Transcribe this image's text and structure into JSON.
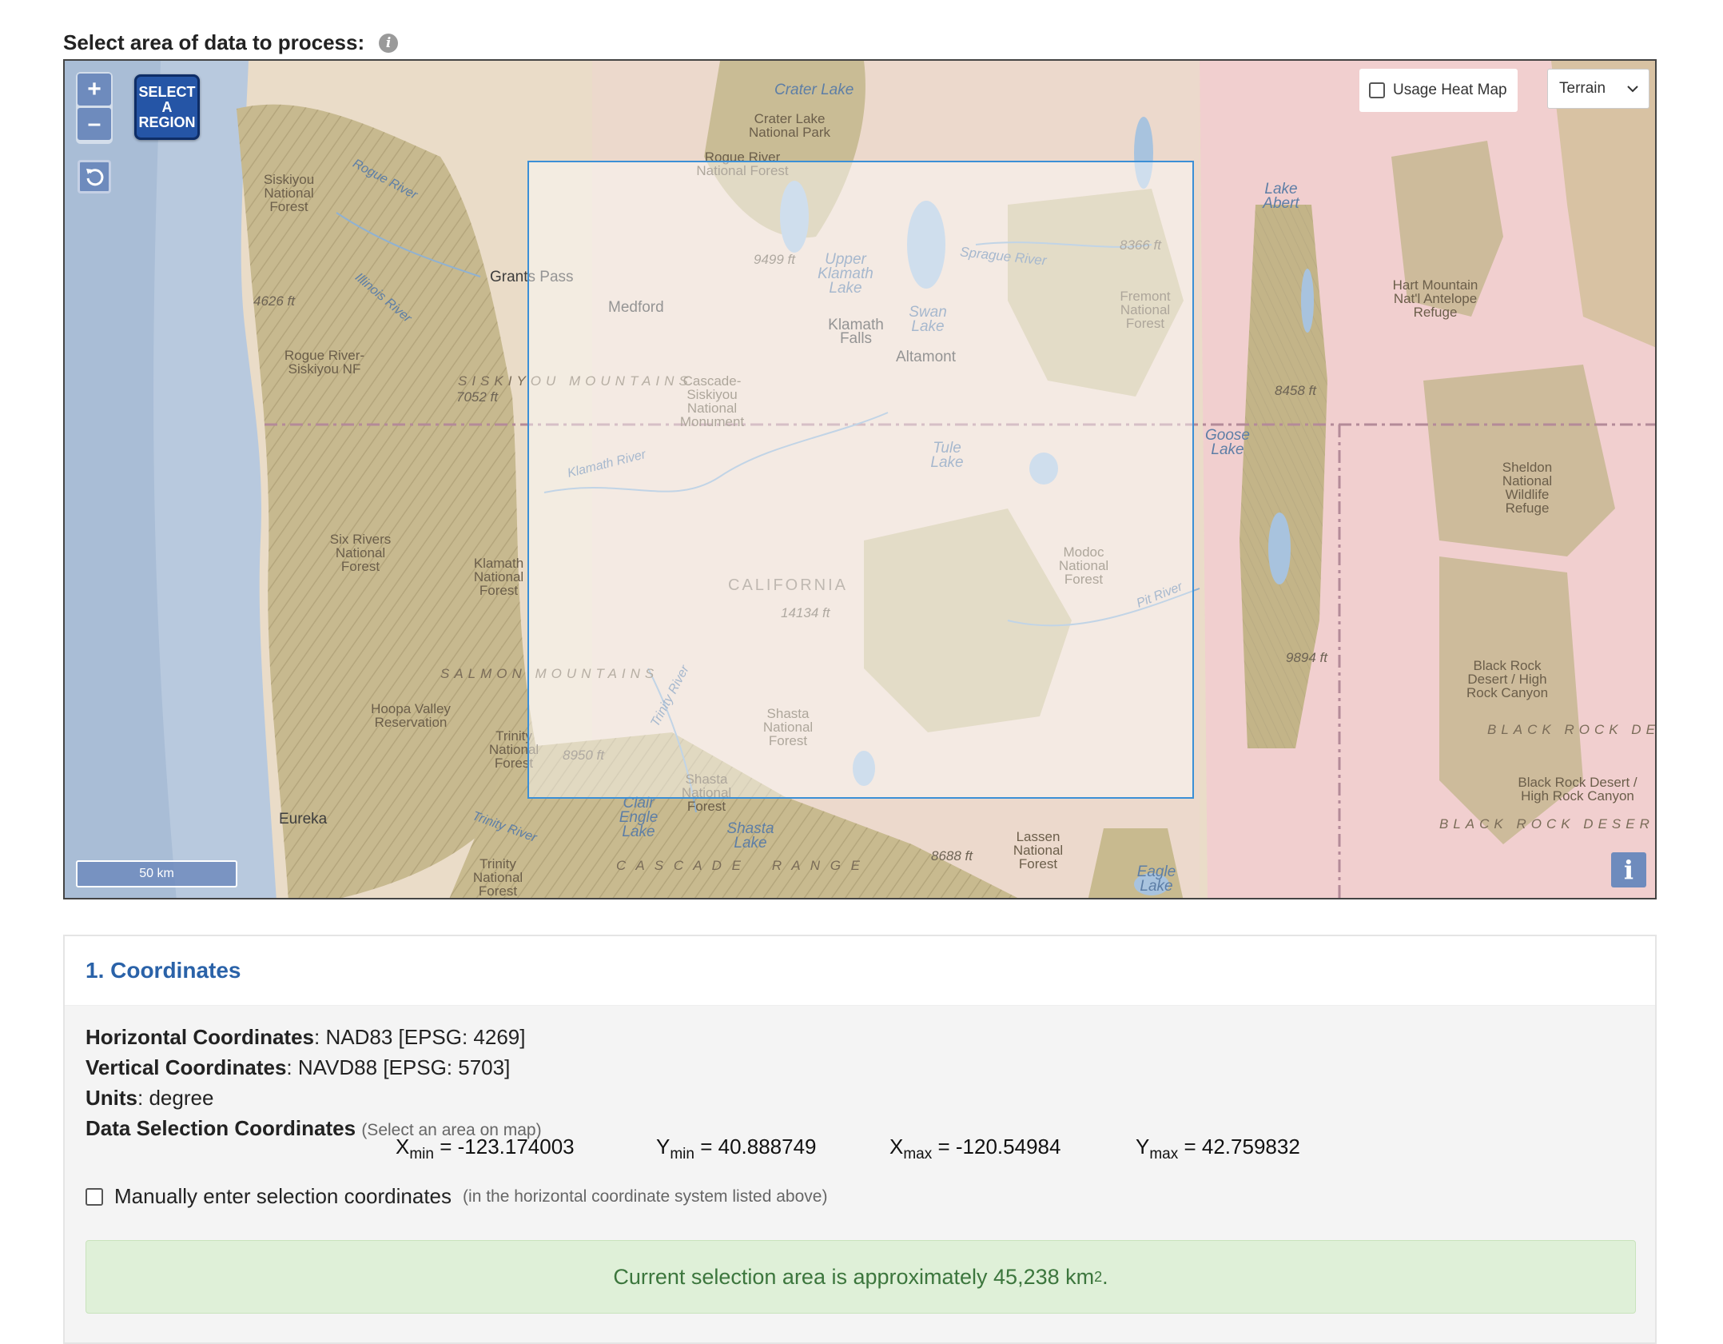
{
  "header": {
    "title": "Select area of data to process:"
  },
  "map": {
    "zoom_in": "+",
    "zoom_out": "–",
    "select_region": [
      "SELECT",
      "A",
      "REGION"
    ],
    "heatmap_label": "Usage Heat Map",
    "basemap_value": "Terrain",
    "scale_label": "50 km",
    "info_label": "i",
    "labels": {
      "crater_lake": "Crater Lake",
      "crater_lake_np": "Crater Lake National Park",
      "rogue_river_nf": "Rogue River National Forest",
      "siskiyou_nf": "Siskiyou National Forest",
      "rogue_river": "Rogue River",
      "illinois_river": "Illinois River",
      "elev_4626": "4626 ft",
      "grants_pass": "Grants Pass",
      "medford": "Medford",
      "elev_9499": "9499 ft",
      "upper_klamath": "Upper Klamath Lake",
      "sprague_river": "Sprague River",
      "elev_8366": "8366 ft",
      "lake_abert": "Lake Abert",
      "hart_mountain": "Hart Mountain Nat'l Antelope Refuge",
      "swan_lake": "Swan Lake",
      "klamath_falls": "Klamath Falls",
      "altamont": "Altamont",
      "fremont_nf": "Fremont National Forest",
      "rogue_siskiyou_nf": "Rogue River-Siskiyou NF",
      "siskiyou_mountains": "SISKIYOU MOUNTAINS",
      "elev_7052": "7052 ft",
      "cascade_siskiyou": "Cascade-Siskiyou National Monument",
      "elev_8458": "8458 ft",
      "goose_lake": "Goose Lake",
      "tule_lake": "Tule Lake",
      "klamath_river": "Klamath River",
      "sheldon": "Sheldon National Wildlife Refuge",
      "six_rivers_nf": "Six Rivers National Forest",
      "klamath_nf": "Klamath National Forest",
      "modoc_nf": "Modoc National Forest",
      "california": "CALIFORNIA",
      "pit_river": "Pit River",
      "elev_14134": "14134 ft",
      "elev_9894": "9894 ft",
      "black_rock_1": "Black Rock Desert / High Rock Canyon",
      "salmon_mountains": "SALMON MOUNTAINS",
      "trinity_river": "Trinity River",
      "hoopa_valley": "Hoopa Valley Reservation",
      "trinity_nf_1": "Trinity National Forest",
      "elev_8950": "8950 ft",
      "shasta_nf_1": "Shasta National Forest",
      "black_rock_de": "BLACK ROCK DE",
      "black_rock_2": "Black Rock Desert / High Rock Canyon",
      "shasta_nf_2": "Shasta National Forest",
      "eureka": "Eureka",
      "trinity_river_2": "Trinity River",
      "clair_engle": "Clair Engle Lake",
      "shasta_lake": "Shasta Lake",
      "lassen_nf": "Lassen National Forest",
      "elev_8688": "8688 ft",
      "black_rock_deser": "BLACK ROCK DESER",
      "trinity_nf_2": "Trinity National Forest",
      "cascade_range": "C A S C A D E    R A N G E",
      "eagle_lake": "Eagle Lake"
    }
  },
  "coordinates_panel": {
    "title": "1. Coordinates",
    "horizontal_label": "Horizontal Coordinates",
    "horizontal_value": ": NAD83 [EPSG: 4269]",
    "vertical_label": "Vertical Coordinates",
    "vertical_value": ": NAVD88 [EPSG: 5703]",
    "units_label": "Units",
    "units_value": ": degree",
    "selection_label": "Data Selection Coordinates",
    "selection_hint": "(Select an area on map)",
    "xmin": "-123.174003",
    "ymin": "40.888749",
    "xmax": "-120.54984",
    "ymax": "42.759832",
    "manual_label": "Manually enter selection coordinates",
    "manual_hint": "(in the horizontal coordinate system listed above)",
    "area_text": "Current selection area is approximately 45,238 km",
    "area_sup": "2",
    "area_period": "."
  }
}
